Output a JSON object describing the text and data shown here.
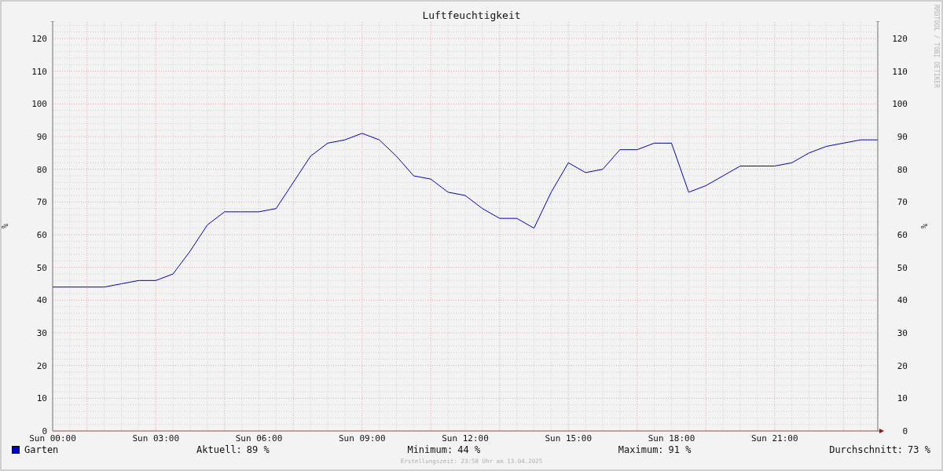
{
  "title": "Luftfeuchtigkeit",
  "credit": "RRDTOOL / TOBI OETIKER",
  "chart": {
    "right_axis": {
      "ylabel": "%",
      "ticks": [
        "120",
        "110",
        "100",
        "90",
        "80",
        "70",
        "60",
        "50",
        "40",
        "30",
        "20",
        "10",
        "0"
      ]
    },
    "chart_data": {
      "type": "line",
      "ylabel": "%",
      "ylim": [
        0,
        125
      ],
      "grid": true,
      "categories": [
        "Sun 00:00",
        null,
        null,
        null,
        null,
        null,
        "Sun 03:00",
        null,
        null,
        null,
        null,
        null,
        "Sun 06:00",
        null,
        null,
        null,
        null,
        null,
        "Sun 09:00",
        null,
        null,
        null,
        null,
        null,
        "Sun 12:00",
        null,
        null,
        null,
        null,
        null,
        "Sun 15:00",
        null,
        null,
        null,
        null,
        null,
        "Sun 18:00",
        null,
        null,
        null,
        null,
        null,
        "Sun 21:00",
        null,
        null,
        null,
        null,
        null,
        null
      ],
      "series": [
        {
          "name": "Garten",
          "color": "#0000cc",
          "values": [
            44,
            44,
            44,
            44,
            45,
            46,
            46,
            48,
            55,
            63,
            67,
            67,
            67,
            68,
            76,
            84,
            88,
            89,
            91,
            89,
            84,
            78,
            77,
            73,
            72,
            68,
            65,
            65,
            62,
            73,
            82,
            79,
            80,
            86,
            86,
            88,
            88,
            73,
            75,
            78,
            81,
            81,
            81,
            82,
            85,
            87,
            88,
            89,
            89
          ]
        }
      ],
      "yticks": [
        0,
        10,
        20,
        30,
        40,
        50,
        60,
        70,
        80,
        90,
        100,
        110,
        120
      ]
    }
  },
  "stats": [
    {
      "label": "Aktuell:",
      "value": "89 %"
    },
    {
      "label": "Minimum:",
      "value": "44 %"
    },
    {
      "label": "Maximum:",
      "value": "91 %"
    },
    {
      "label": "Durchschnitt:",
      "value": "73 %"
    }
  ],
  "footer": "Erstellungszeit: 23:58 Uhr am 13.04.2025"
}
